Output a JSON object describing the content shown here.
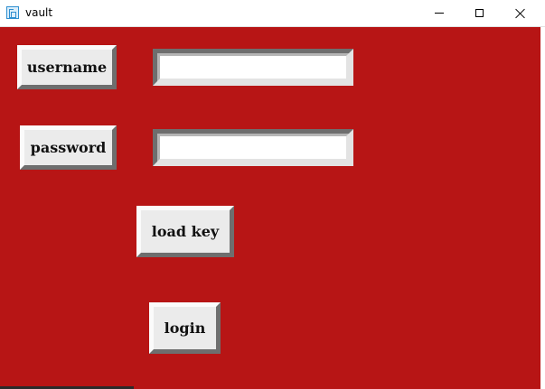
{
  "window": {
    "title": "vault",
    "icon": "app-icon"
  },
  "titlebar_controls": {
    "minimize": "minimize-icon",
    "maximize": "maximize-icon",
    "close": "close-icon"
  },
  "form": {
    "username_label": "username",
    "username_value": "",
    "password_label": "password",
    "password_value": "",
    "load_key_label": "load key",
    "login_label": "login"
  },
  "colors": {
    "background": "#b71515",
    "button_face": "#ebebeb",
    "entry_face": "#ffffff"
  }
}
